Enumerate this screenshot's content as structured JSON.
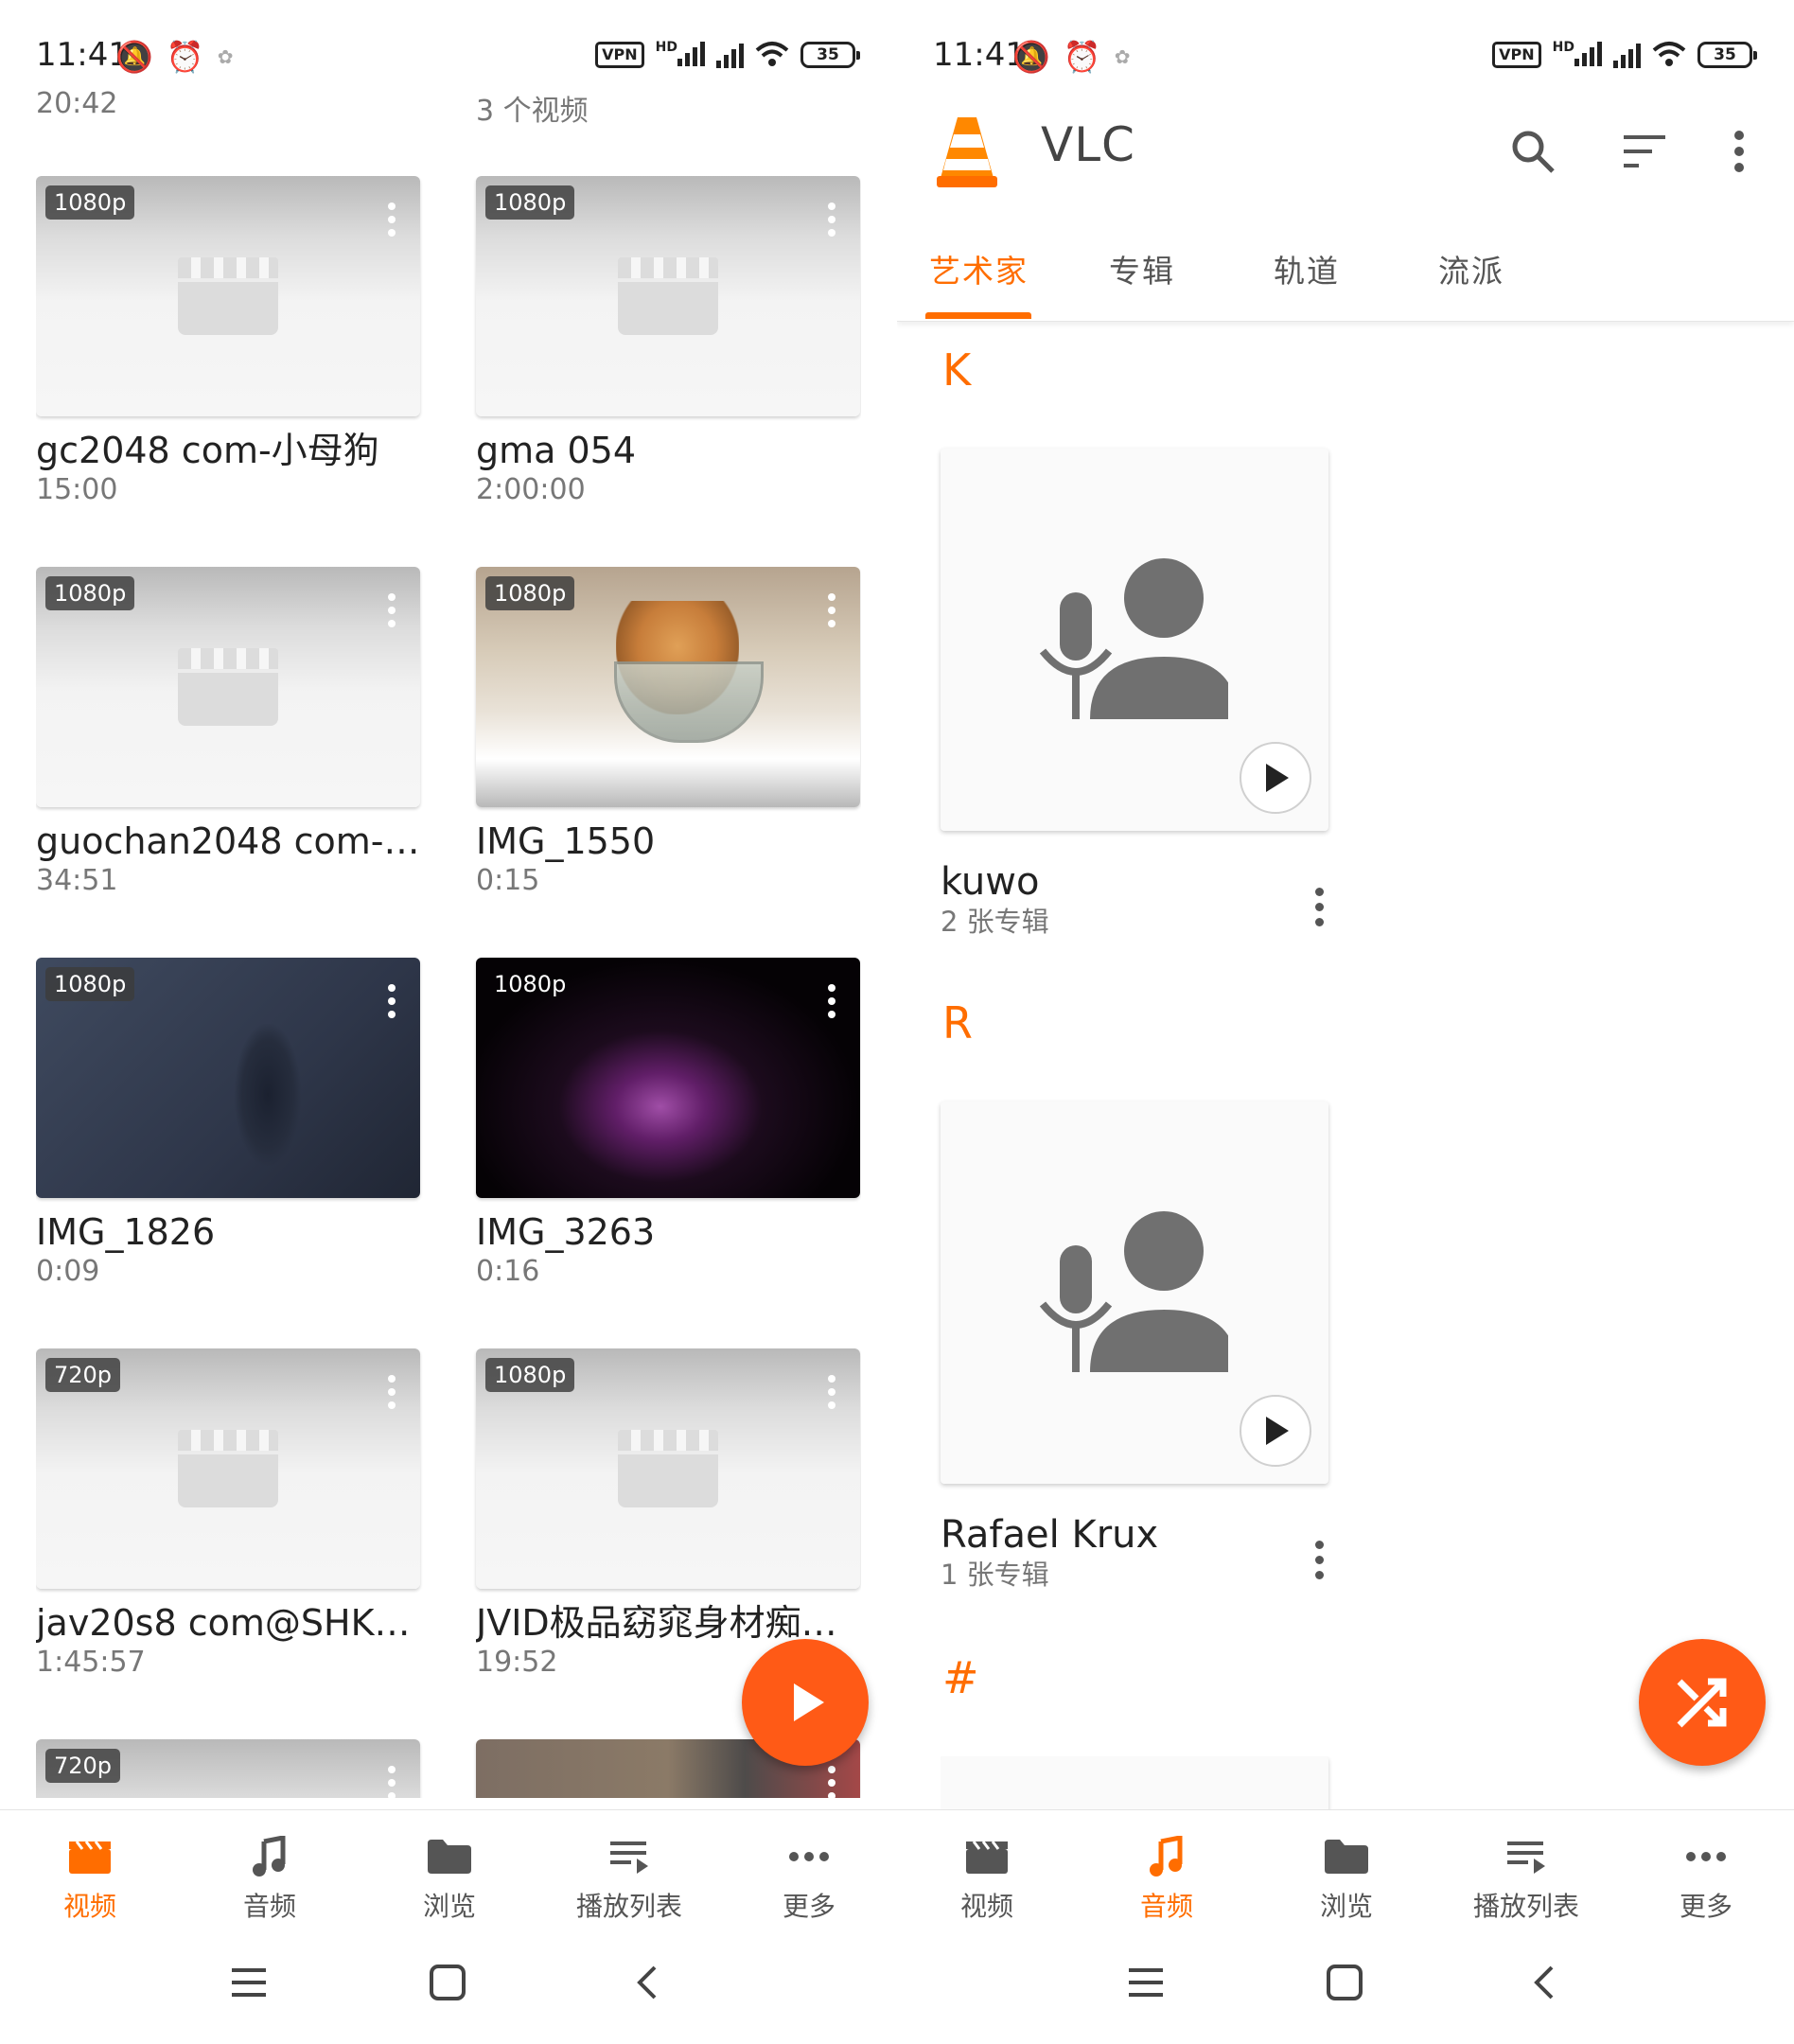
{
  "status_bar": {
    "time": "11:41",
    "battery": "35",
    "vpn": "VPN",
    "hd": "HD"
  },
  "left": {
    "top_info_left": "20:42",
    "top_info_right": "3 个视频",
    "videos": [
      {
        "resolution": "1080p",
        "title": "gc2048 com-小母狗",
        "duration": "15:00"
      },
      {
        "resolution": "1080p",
        "title": "gma 054",
        "duration": "2:00:00"
      },
      {
        "resolution": "1080p",
        "title": "guochan2048 com-…",
        "duration": "34:51"
      },
      {
        "resolution": "1080p",
        "title": "IMG_1550",
        "duration": "0:15"
      },
      {
        "resolution": "1080p",
        "title": "IMG_1826",
        "duration": "0:09"
      },
      {
        "resolution": "1080p",
        "title": "IMG_3263",
        "duration": "0:16"
      },
      {
        "resolution": "720p",
        "title": "jav20s8 com@SHK…",
        "duration": "1:45:57"
      },
      {
        "resolution": "1080p",
        "title": "JVID极品窈窕身材痴…",
        "duration": "19:52"
      },
      {
        "resolution": "720p",
        "title": "",
        "duration": ""
      },
      {
        "resolution": "",
        "title": "",
        "duration": ""
      }
    ]
  },
  "right": {
    "app_title": "VLC",
    "tabs": [
      "艺术家",
      "专辑",
      "轨道",
      "流派"
    ],
    "active_tab": "艺术家",
    "sections": [
      {
        "letter": "K",
        "name": "kuwo",
        "count": "2 张专辑"
      },
      {
        "letter": "R",
        "name": "Rafael Krux",
        "count": "1 张专辑"
      },
      {
        "letter": "#",
        "name": "",
        "count": ""
      }
    ]
  },
  "bottom_nav": {
    "items": [
      "视频",
      "音频",
      "浏览",
      "播放列表",
      "更多"
    ],
    "active_left": "视频",
    "active_right": "音频"
  },
  "colors": {
    "accent": "#ff6d00",
    "fab": "#ff5a16",
    "text_primary": "#222222",
    "text_secondary": "#777777",
    "icon_gray": "#555555"
  },
  "icons": {
    "nav": [
      "movie-clapper-icon",
      "music-note-icon",
      "folder-icon",
      "playlist-icon",
      "more-horiz-icon"
    ],
    "appbar": [
      "search-icon",
      "sort-icon",
      "more-vert-icon"
    ],
    "fab_left": "play-icon",
    "fab_right": "shuffle-icon"
  }
}
